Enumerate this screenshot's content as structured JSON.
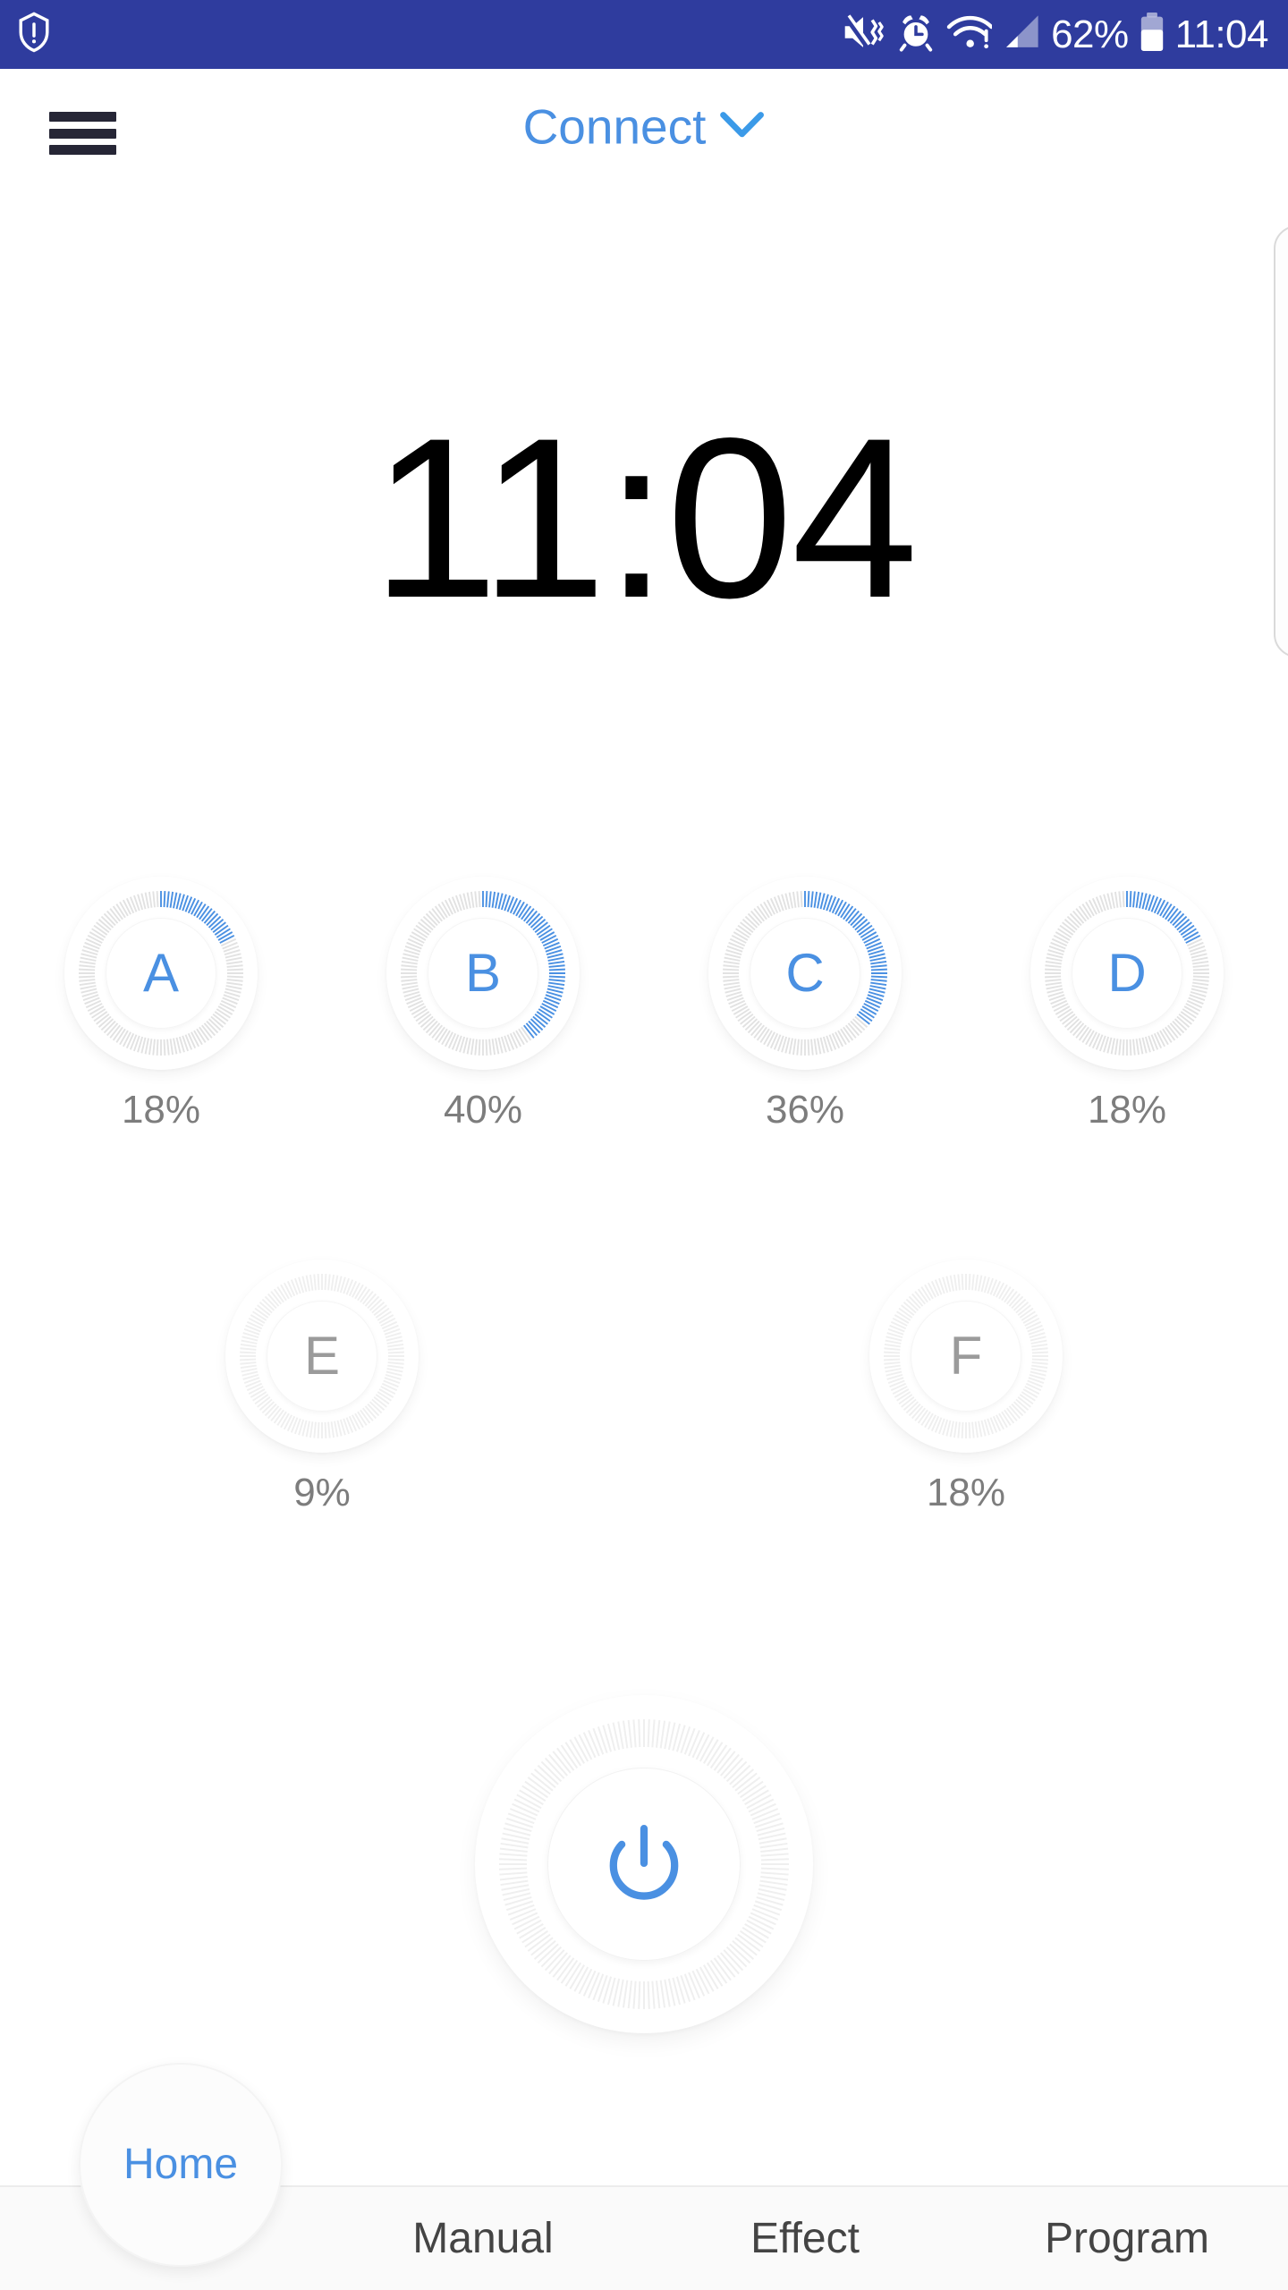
{
  "statusbar": {
    "background": "#2f3c9e",
    "battery_percent": "62%",
    "time": "11:04",
    "icons": [
      "shield-warning-icon",
      "mute-vibrate-icon",
      "alarm-clock-icon",
      "wifi-warning-icon",
      "cellular-signal-icon",
      "battery-icon"
    ]
  },
  "header": {
    "menu_icon": "hamburger-menu-icon",
    "connect_label": "Connect",
    "dropdown_icon": "chevron-down-icon"
  },
  "clock": {
    "time": "11:04"
  },
  "theme": {
    "accent_blue": "#4a90e2",
    "status_blue": "#2f3c9e",
    "inactive_gray": "#9b9b9b",
    "label_gray": "#7d7d7d",
    "menu_dark": "#262636"
  },
  "channels": [
    {
      "letter": "A",
      "percent": "18%",
      "value": 18,
      "active": true
    },
    {
      "letter": "B",
      "percent": "40%",
      "value": 40,
      "active": true
    },
    {
      "letter": "C",
      "percent": "36%",
      "value": 36,
      "active": true
    },
    {
      "letter": "D",
      "percent": "18%",
      "value": 18,
      "active": true
    },
    {
      "letter": "E",
      "percent": "9%",
      "value": 9,
      "active": false
    },
    {
      "letter": "F",
      "percent": "18%",
      "value": 18,
      "active": false
    }
  ],
  "power": {
    "icon": "power-icon",
    "state": "on"
  },
  "bottom_nav": {
    "items": [
      {
        "label": "Home",
        "active": true
      },
      {
        "label": "Manual",
        "active": false
      },
      {
        "label": "Effect",
        "active": false
      },
      {
        "label": "Program",
        "active": false
      }
    ]
  },
  "side_panel": {
    "visible": true
  }
}
